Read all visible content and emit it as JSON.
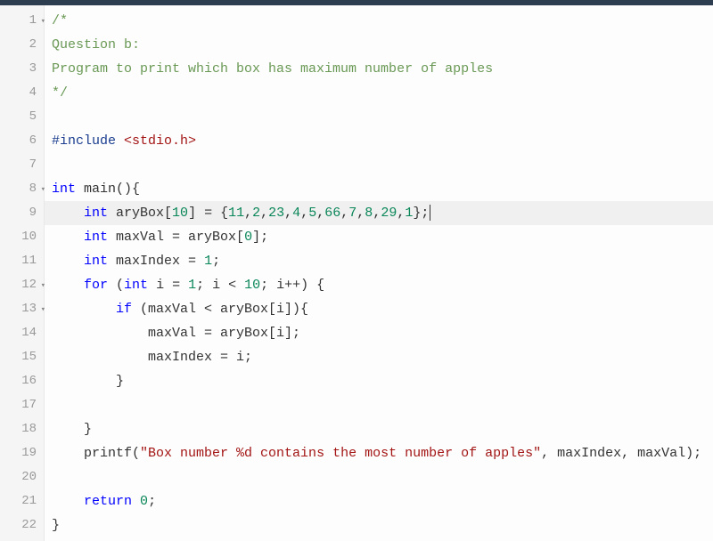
{
  "lines": [
    {
      "num": "1",
      "fold": true,
      "highlighted": false,
      "tokens": [
        {
          "t": "/*",
          "c": "comment"
        }
      ]
    },
    {
      "num": "2",
      "fold": false,
      "highlighted": false,
      "tokens": [
        {
          "t": "Question b:",
          "c": "comment"
        }
      ]
    },
    {
      "num": "3",
      "fold": false,
      "highlighted": false,
      "tokens": [
        {
          "t": "Program to print which box has maximum number of apples",
          "c": "comment"
        }
      ]
    },
    {
      "num": "4",
      "fold": false,
      "highlighted": false,
      "tokens": [
        {
          "t": "*/",
          "c": "comment"
        }
      ]
    },
    {
      "num": "5",
      "fold": false,
      "highlighted": false,
      "tokens": []
    },
    {
      "num": "6",
      "fold": false,
      "highlighted": false,
      "tokens": [
        {
          "t": "#include ",
          "c": "preproc"
        },
        {
          "t": "<stdio.h>",
          "c": "header-name"
        }
      ]
    },
    {
      "num": "7",
      "fold": false,
      "highlighted": false,
      "tokens": []
    },
    {
      "num": "8",
      "fold": true,
      "highlighted": false,
      "tokens": [
        {
          "t": "int",
          "c": "type"
        },
        {
          "t": " ",
          "c": ""
        },
        {
          "t": "main",
          "c": "ident"
        },
        {
          "t": "(){",
          "c": "punct"
        }
      ]
    },
    {
      "num": "9",
      "fold": false,
      "highlighted": true,
      "tokens": [
        {
          "t": "    ",
          "c": ""
        },
        {
          "t": "int",
          "c": "type"
        },
        {
          "t": " aryBox[",
          "c": "ident"
        },
        {
          "t": "10",
          "c": "number"
        },
        {
          "t": "] = {",
          "c": "punct"
        },
        {
          "t": "11",
          "c": "number"
        },
        {
          "t": ",",
          "c": "punct"
        },
        {
          "t": "2",
          "c": "number"
        },
        {
          "t": ",",
          "c": "punct"
        },
        {
          "t": "23",
          "c": "number"
        },
        {
          "t": ",",
          "c": "punct"
        },
        {
          "t": "4",
          "c": "number"
        },
        {
          "t": ",",
          "c": "punct"
        },
        {
          "t": "5",
          "c": "number"
        },
        {
          "t": ",",
          "c": "punct"
        },
        {
          "t": "66",
          "c": "number"
        },
        {
          "t": ",",
          "c": "punct"
        },
        {
          "t": "7",
          "c": "number"
        },
        {
          "t": ",",
          "c": "punct"
        },
        {
          "t": "8",
          "c": "number"
        },
        {
          "t": ",",
          "c": "punct"
        },
        {
          "t": "29",
          "c": "number"
        },
        {
          "t": ",",
          "c": "punct"
        },
        {
          "t": "1",
          "c": "number"
        },
        {
          "t": "};",
          "c": "punct"
        }
      ],
      "cursor": true
    },
    {
      "num": "10",
      "fold": false,
      "highlighted": false,
      "tokens": [
        {
          "t": "    ",
          "c": ""
        },
        {
          "t": "int",
          "c": "type"
        },
        {
          "t": " maxVal = aryBox[",
          "c": "ident"
        },
        {
          "t": "0",
          "c": "number"
        },
        {
          "t": "];",
          "c": "punct"
        }
      ]
    },
    {
      "num": "11",
      "fold": false,
      "highlighted": false,
      "tokens": [
        {
          "t": "    ",
          "c": ""
        },
        {
          "t": "int",
          "c": "type"
        },
        {
          "t": " maxIndex = ",
          "c": "ident"
        },
        {
          "t": "1",
          "c": "number"
        },
        {
          "t": ";",
          "c": "punct"
        }
      ]
    },
    {
      "num": "12",
      "fold": true,
      "highlighted": false,
      "tokens": [
        {
          "t": "    ",
          "c": ""
        },
        {
          "t": "for",
          "c": "keyword"
        },
        {
          "t": " (",
          "c": "punct"
        },
        {
          "t": "int",
          "c": "type"
        },
        {
          "t": " i = ",
          "c": "ident"
        },
        {
          "t": "1",
          "c": "number"
        },
        {
          "t": "; i < ",
          "c": "ident"
        },
        {
          "t": "10",
          "c": "number"
        },
        {
          "t": "; i++) {",
          "c": "punct"
        }
      ]
    },
    {
      "num": "13",
      "fold": true,
      "highlighted": false,
      "tokens": [
        {
          "t": "        ",
          "c": ""
        },
        {
          "t": "if",
          "c": "keyword"
        },
        {
          "t": " (maxVal < aryBox[i]){",
          "c": "ident"
        }
      ]
    },
    {
      "num": "14",
      "fold": false,
      "highlighted": false,
      "tokens": [
        {
          "t": "            maxVal = aryBox[i];",
          "c": "ident"
        }
      ]
    },
    {
      "num": "15",
      "fold": false,
      "highlighted": false,
      "tokens": [
        {
          "t": "            maxIndex = i;",
          "c": "ident"
        }
      ]
    },
    {
      "num": "16",
      "fold": false,
      "highlighted": false,
      "tokens": [
        {
          "t": "        }",
          "c": "punct"
        }
      ]
    },
    {
      "num": "17",
      "fold": false,
      "highlighted": false,
      "tokens": []
    },
    {
      "num": "18",
      "fold": false,
      "highlighted": false,
      "tokens": [
        {
          "t": "    }",
          "c": "punct"
        }
      ]
    },
    {
      "num": "19",
      "fold": false,
      "highlighted": false,
      "tokens": [
        {
          "t": "    printf(",
          "c": "ident"
        },
        {
          "t": "\"Box number %d contains the most number of apples\"",
          "c": "string"
        },
        {
          "t": ", maxIndex, maxVal);",
          "c": "ident"
        }
      ]
    },
    {
      "num": "20",
      "fold": false,
      "highlighted": false,
      "tokens": []
    },
    {
      "num": "21",
      "fold": false,
      "highlighted": false,
      "tokens": [
        {
          "t": "    ",
          "c": ""
        },
        {
          "t": "return",
          "c": "keyword"
        },
        {
          "t": " ",
          "c": ""
        },
        {
          "t": "0",
          "c": "number"
        },
        {
          "t": ";",
          "c": "punct"
        }
      ]
    },
    {
      "num": "22",
      "fold": false,
      "highlighted": false,
      "tokens": [
        {
          "t": "}",
          "c": "punct"
        }
      ]
    }
  ]
}
